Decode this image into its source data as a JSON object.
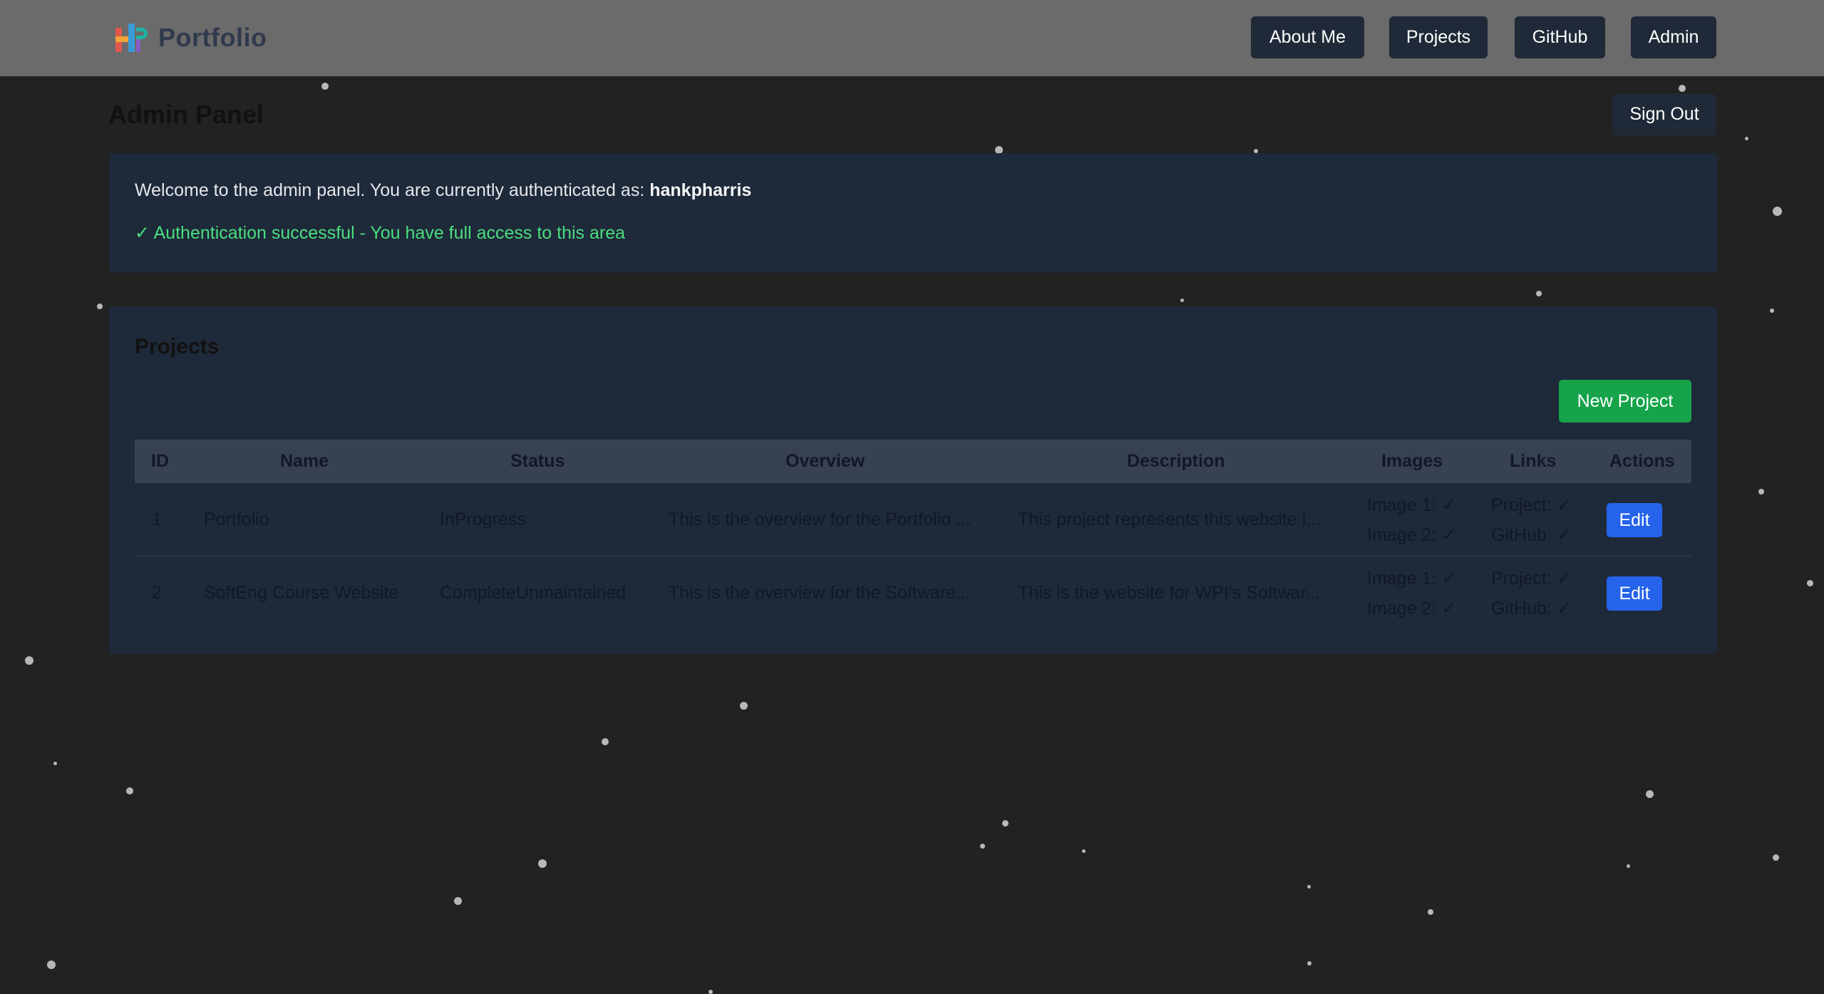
{
  "header": {
    "brand": "Portfolio",
    "nav": [
      "About Me",
      "Projects",
      "GitHub",
      "Admin"
    ]
  },
  "admin": {
    "title": "Admin Panel",
    "sign_out": "Sign Out",
    "welcome_prefix": "Welcome to the admin panel. You are currently authenticated as:",
    "username": "hankpharris",
    "auth_status": "✓ Authentication successful - You have full access to this area"
  },
  "projects": {
    "title": "Projects",
    "new_button": "New Project",
    "columns": [
      "ID",
      "Name",
      "Status",
      "Overview",
      "Description",
      "Images",
      "Links",
      "Actions"
    ],
    "rows": [
      {
        "id": "1",
        "name": "Portfolio",
        "status": "InProgress",
        "overview": "This is the overview for the Portfolio ...",
        "description": "This project represents this website i...",
        "image1": "Image 1: ✓",
        "image2": "Image 2: ✓",
        "link_project": "Project: ✓",
        "link_github": "GitHub: ✓",
        "action": "Edit"
      },
      {
        "id": "2",
        "name": "SoftEng Course Website",
        "status": "CompleteUnmaintained",
        "overview": "This is the overview for the Software...",
        "description": "This is the website for WPI's Softwar...",
        "image1": "Image 1: ✓",
        "image2": "Image 2: ✓",
        "link_project": "Project: ✓",
        "link_github": "GitHub: ✓",
        "action": "Edit"
      }
    ]
  },
  "colors": {
    "topbar": "#6b6b6b",
    "background": "#222222",
    "panel": "#1e2939",
    "button_dark": "#1f2937",
    "success_green": "#16a34a",
    "edit_blue": "#2563eb",
    "auth_text": "#4ade80"
  }
}
